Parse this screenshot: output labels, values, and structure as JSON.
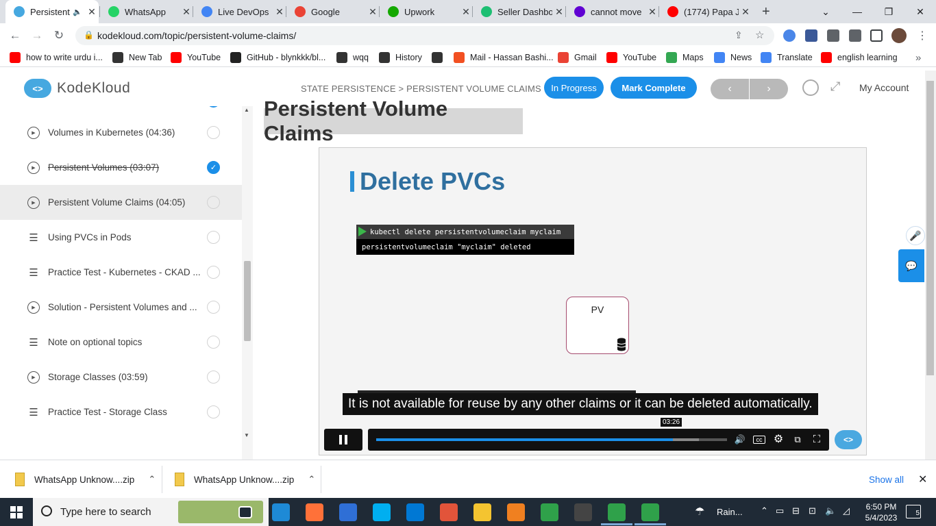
{
  "browser": {
    "tabs": [
      {
        "title": "Persistent",
        "favicon": "kodekloud-icon",
        "color": "#46a8e0"
      },
      {
        "title": "WhatsApp",
        "favicon": "whatsapp-icon",
        "color": "#25d366"
      },
      {
        "title": "Live DevOps",
        "favicon": "docs-icon",
        "color": "#4285f4"
      },
      {
        "title": "Google",
        "favicon": "google-icon",
        "color": "#ea4335"
      },
      {
        "title": "Upwork",
        "favicon": "upwork-icon",
        "color": "#14a800"
      },
      {
        "title": "Seller Dashbo",
        "favicon": "fiverr-icon",
        "color": "#1dbf73"
      },
      {
        "title": "cannot move",
        "favicon": "yahoo-icon",
        "color": "#6001d2"
      },
      {
        "title": "(1774) Papa J",
        "favicon": "youtube-icon",
        "color": "#ff0000"
      }
    ],
    "new_tab": "+",
    "url": "kodekloud.com/topic/persistent-volume-claims/",
    "bookmarks": [
      {
        "label": "how to write urdu i...",
        "icon": "youtube-icon",
        "color": "#ff0000"
      },
      {
        "label": "New Tab",
        "icon": "globe-icon",
        "color": "#333333"
      },
      {
        "label": "YouTube",
        "icon": "youtube-icon",
        "color": "#ff0000"
      },
      {
        "label": "GitHub - blynkkk/bl...",
        "icon": "github-icon",
        "color": "#222222"
      },
      {
        "label": "wqq",
        "icon": "download-icon",
        "color": "#333333"
      },
      {
        "label": "History",
        "icon": "history-icon",
        "color": "#333333"
      },
      {
        "label": "",
        "icon": "globe-icon",
        "color": "#333333"
      },
      {
        "label": "Mail - Hassan Bashi...",
        "icon": "microsoft-icon",
        "color": "#f25022"
      },
      {
        "label": "Gmail",
        "icon": "gmail-icon",
        "color": "#ea4335"
      },
      {
        "label": "YouTube",
        "icon": "youtube-icon",
        "color": "#ff0000"
      },
      {
        "label": "Maps",
        "icon": "maps-icon",
        "color": "#34a853"
      },
      {
        "label": "News",
        "icon": "news-icon",
        "color": "#4285f4"
      },
      {
        "label": "Translate",
        "icon": "translate-icon",
        "color": "#4285f4"
      },
      {
        "label": "english learning",
        "icon": "youtube-icon",
        "color": "#ff0000"
      }
    ]
  },
  "header": {
    "logo_text": "KodeKloud",
    "breadcrumb": "STATE PERSISTENCE > PERSISTENT VOLUME CLAIMS",
    "in_progress": "In Progress",
    "mark_complete": "Mark Complete",
    "prev": "‹",
    "next": "›",
    "my_account": "My Account"
  },
  "sidebar": {
    "lessons": [
      {
        "label": "Volumes in Kubernetes (04:36)",
        "type": "video",
        "done": false,
        "selected": false
      },
      {
        "label": "Persistent Volumes (03:07)",
        "type": "video",
        "done": true,
        "selected": false
      },
      {
        "label": "Persistent Volume Claims (04:05)",
        "type": "video",
        "done": false,
        "selected": true
      },
      {
        "label": "Using PVCs in Pods",
        "type": "doc",
        "done": false,
        "selected": false
      },
      {
        "label": "Practice Test - Kubernetes - CKAD ...",
        "type": "doc",
        "done": false,
        "selected": false
      },
      {
        "label": "Solution - Persistent Volumes and ...",
        "type": "video",
        "done": false,
        "selected": false
      },
      {
        "label": "Note on optional topics",
        "type": "doc",
        "done": false,
        "selected": false
      },
      {
        "label": "Storage Classes (03:59)",
        "type": "video",
        "done": false,
        "selected": false
      },
      {
        "label": "Practice Test - Storage Class",
        "type": "doc",
        "done": false,
        "selected": false
      }
    ]
  },
  "main": {
    "title": "Persistent Volume Claims",
    "video": {
      "slide_title": "Delete PVCs",
      "command": "kubectl delete persistentvolumeclaim myclaim",
      "output": "persistentvolumeclaim \"myclaim\" deleted",
      "pv_label": "PV",
      "caption": "It is not available for reuse by any other claims or it can be deleted automatically.",
      "time": "03:26",
      "progress": 0.845,
      "buffered": 0.92
    }
  },
  "downloads": {
    "items": [
      "WhatsApp Unknow....zip",
      "WhatsApp Unknow....zip"
    ],
    "show_all": "Show all"
  },
  "taskbar": {
    "search_placeholder": "Type here to search",
    "weather": "Rain...",
    "time": "6:50 PM",
    "date": "5/4/2023",
    "notifications": "5",
    "apps": [
      {
        "name": "task-view-icon",
        "color": "#1f2a36"
      },
      {
        "name": "edge-icon",
        "color": "#1e8ad6"
      },
      {
        "name": "firefox-icon",
        "color": "#ff7139"
      },
      {
        "name": "store-icon",
        "color": "#2f6fd6"
      },
      {
        "name": "skype-icon",
        "color": "#00aff0"
      },
      {
        "name": "mail-icon",
        "color": "#0078d4"
      },
      {
        "name": "app-icon",
        "color": "#e2543a"
      },
      {
        "name": "file-explorer-icon",
        "color": "#f4c430"
      },
      {
        "name": "vlc-icon",
        "color": "#f08020"
      },
      {
        "name": "chrome-icon",
        "color": "#2fa14a"
      },
      {
        "name": "obs-icon",
        "color": "#444444"
      },
      {
        "name": "chrome-icon",
        "color": "#2fa14a"
      },
      {
        "name": "chrome-icon",
        "color": "#2fa14a"
      }
    ]
  }
}
